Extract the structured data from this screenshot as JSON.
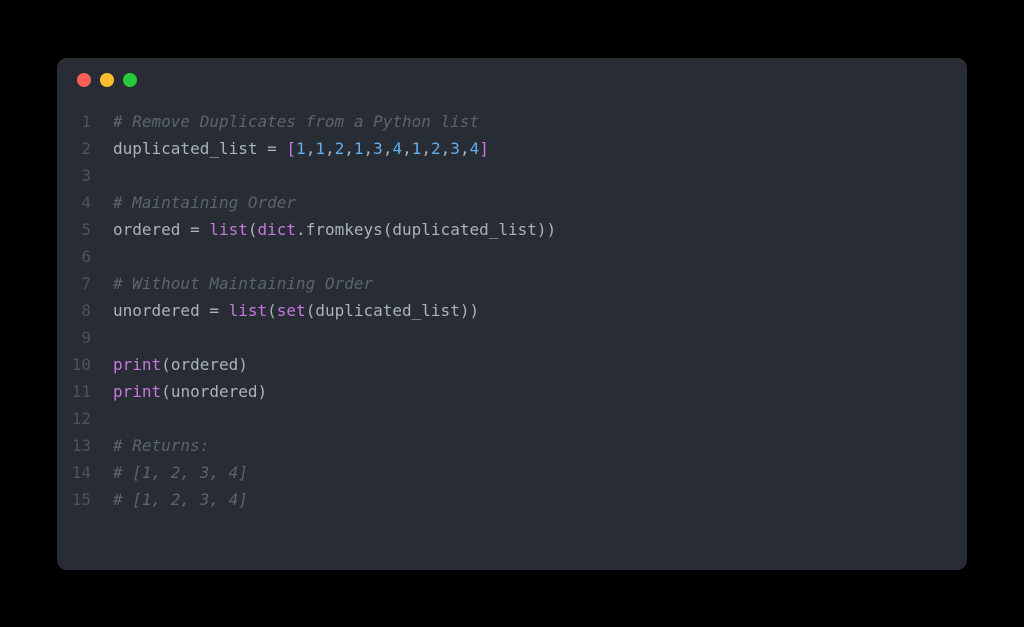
{
  "traffic_lights": {
    "red": "close",
    "yellow": "minimize",
    "green": "zoom"
  },
  "lines": {
    "l1_no": "1",
    "l1_comment": "# Remove Duplicates from a Python list",
    "l2_no": "2",
    "l2_var": "duplicated_list",
    "l2_eq": " = ",
    "l2_lb": "[",
    "l2_n1": "1",
    "l2_c1": ",",
    "l2_n2": "1",
    "l2_c2": ",",
    "l2_n3": "2",
    "l2_c3": ",",
    "l2_n4": "1",
    "l2_c4": ",",
    "l2_n5": "3",
    "l2_c5": ",",
    "l2_n6": "4",
    "l2_c6": ",",
    "l2_n7": "1",
    "l2_c7": ",",
    "l2_n8": "2",
    "l2_c8": ",",
    "l2_n9": "3",
    "l2_c9": ",",
    "l2_n10": "4",
    "l2_rb": "]",
    "l3_no": "3",
    "l4_no": "4",
    "l4_comment": "# Maintaining Order",
    "l5_no": "5",
    "l5_var": "ordered",
    "l5_eq": " = ",
    "l5_list": "list",
    "l5_lp1": "(",
    "l5_dict": "dict",
    "l5_dot": ".",
    "l5_fromkeys": "fromkeys",
    "l5_lp2": "(",
    "l5_arg": "duplicated_list",
    "l5_rp2": ")",
    "l5_rp1": ")",
    "l6_no": "6",
    "l7_no": "7",
    "l7_comment": "# Without Maintaining Order",
    "l8_no": "8",
    "l8_var": "unordered",
    "l8_eq": " = ",
    "l8_list": "list",
    "l8_lp1": "(",
    "l8_set": "set",
    "l8_lp2": "(",
    "l8_arg": "duplicated_list",
    "l8_rp2": ")",
    "l8_rp1": ")",
    "l9_no": "9",
    "l10_no": "10",
    "l10_print": "print",
    "l10_lp": "(",
    "l10_arg": "ordered",
    "l10_rp": ")",
    "l11_no": "11",
    "l11_print": "print",
    "l11_lp": "(",
    "l11_arg": "unordered",
    "l11_rp": ")",
    "l12_no": "12",
    "l13_no": "13",
    "l13_comment": "# Returns:",
    "l14_no": "14",
    "l14_comment": "# [1, 2, 3, 4]",
    "l15_no": "15",
    "l15_comment": "# [1, 2, 3, 4]"
  }
}
